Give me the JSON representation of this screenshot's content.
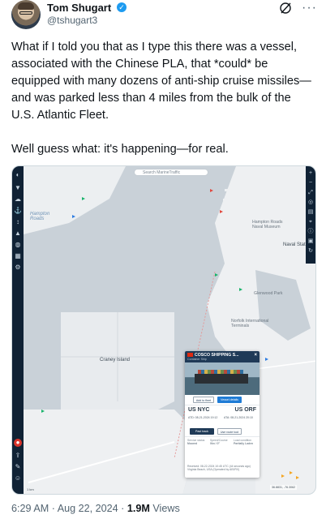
{
  "author": {
    "name": "Tom Shugart",
    "handle": "@tshugart3",
    "verified": true
  },
  "tweet": {
    "paragraphs": [
      "What if I told you that as I type this there was a vessel, associated with the Chinese PLA, that *could* be equipped with many dozens of anti-ship cruise missiles—and was parked less than 4 miles from the bulk of the U.S. Atlantic Fleet.",
      "Well guess what: it's happening—for real."
    ]
  },
  "map": {
    "search_placeholder": "Search MarineTraffic",
    "labels": {
      "hampton_roads": "Hampton\nRoads",
      "craney_island": "Craney Island",
      "naval_station": "Naval Stat",
      "hampton_roads_naval": "Hampton Roads\nNaval Museum",
      "norfolk_international": "Norfolk International\nTerminals",
      "grounds": "Glenwood Park"
    },
    "vessel_card": {
      "name": "COSCO SHIPPING S...",
      "type": "Container Ship",
      "add_to_fleet": "Add to fleet",
      "vessel_details": "Vessel details",
      "departure_port": "US NYC",
      "arrival_port": "US ORF",
      "atd": "ATD: 08-21-2024 19:12",
      "ata": "ATA: 08-21-2024 20:10",
      "past_track": "Past track",
      "route_tool": "Use route tool",
      "status_label": "Service status",
      "status_value": "Moored",
      "speed_label": "Speed/Course",
      "speed_value": "0kn / 0°",
      "draught_label": "Load condition",
      "draught_value": "Partially Laden",
      "received": "Received: 08-22-2024 10:45 UTC (44 seconds ago) Virginia Beach, USA (Operated by AIS/RX)"
    },
    "scale": "1 km",
    "coords": "36.8831, -76.3062"
  },
  "meta": {
    "time": "6:29 AM",
    "date": "Aug 22, 2024",
    "sep": "·",
    "views_count": "1.9M",
    "views_label": "Views"
  },
  "colors": {
    "accent": "#1d9bf0",
    "map_water": "#cbd3da",
    "map_land": "#eef0f2",
    "map_sidebar": "#102235"
  }
}
